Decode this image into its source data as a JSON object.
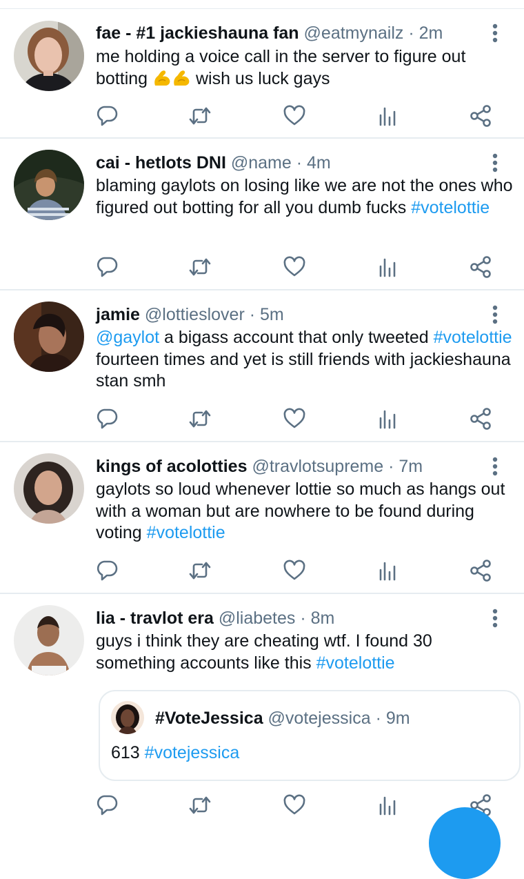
{
  "tweets": [
    {
      "name": "fae - #1 jackieshauna fan",
      "handle": "@eatmynailz",
      "time": "2m",
      "text_a": "me holding a voice call in the server to figure out botting",
      "emoji": "💪💪",
      "text_b": "wish us luck gays"
    },
    {
      "name": "cai - hetlots DNI",
      "handle": "@name",
      "time": "4m",
      "text": "blaming gaylots on losing like we are not the ones who figured out botting for all you dumb fucks",
      "hashtag": "#votelottie"
    },
    {
      "name": "jamie",
      "handle": "@lottieslover",
      "time": "5m",
      "mention": "@gaylot",
      "text_a": "a bigass account that only tweeted",
      "hashtag": "#votelottie",
      "text_b": "fourteen times and yet is still friends with jackieshauna stan smh"
    },
    {
      "name": "kings of acolotties",
      "handle": "@travlotsupreme",
      "time": "7m",
      "text": "gaylots so loud whenever lottie so much as hangs out with a woman but are nowhere to be found during voting",
      "hashtag": "#votelottie"
    },
    {
      "name": "lia - travlot era",
      "handle": "@liabetes",
      "time": "8m",
      "text": "guys i think they are cheating wtf. I found 30 something accounts like this",
      "hashtag": "#votelottie",
      "quote": {
        "name": "#VoteJessica",
        "handle": "@votejessica",
        "time": "9m",
        "text": "613",
        "hashtag": "#votejessica"
      }
    }
  ],
  "separator": "·",
  "colors": {
    "accent": "#1d9bf0",
    "secondary_text": "#5b7083",
    "divider": "#e6ecf0"
  },
  "icons": [
    "reply-icon",
    "retweet-icon",
    "like-icon",
    "analytics-icon",
    "share-icon",
    "more-icon"
  ]
}
